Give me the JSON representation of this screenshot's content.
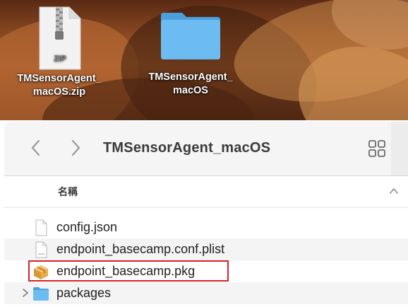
{
  "desktop": {
    "zip_item": {
      "badge": "ZIP",
      "label_line1": "TMSensorAgent_",
      "label_line2": "macOS.zip",
      "icon": "zip-file-icon"
    },
    "folder_item": {
      "label_line1": "TMSensorAgent_",
      "label_line2": "macOS",
      "icon": "folder-icon"
    }
  },
  "finder": {
    "title": "TMSensorAgent_macOS",
    "back_icon": "chevron-left-icon",
    "forward_icon": "chevron-right-icon",
    "view_icon": "grid-view-icon",
    "column_name": "名稱",
    "sort_icon": "chevron-up-icon",
    "files": [
      {
        "name": "config.json",
        "icon": "document-icon"
      },
      {
        "name": "endpoint_basecamp.conf.plist",
        "icon": "document-icon"
      },
      {
        "name": "endpoint_basecamp.pkg",
        "icon": "package-icon"
      },
      {
        "name": "packages",
        "icon": "folder-icon"
      }
    ],
    "highlight_color": "#d8222b",
    "folder_color": "#5aaeea"
  }
}
